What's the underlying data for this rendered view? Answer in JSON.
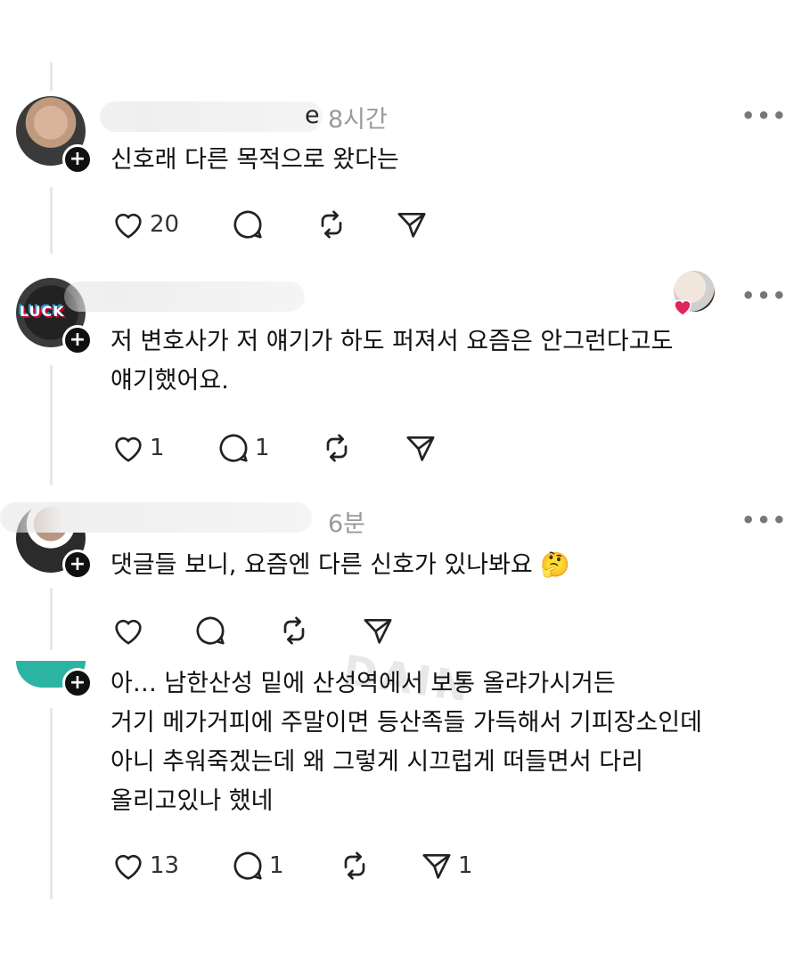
{
  "watermark": "DAIN",
  "comments": [
    {
      "time": "8시간",
      "name_fragment": "e",
      "text_lines": [
        "신호래 다른 목적으로 왔다는"
      ],
      "likes": "20",
      "replies": "",
      "reposts": "",
      "shares": ""
    },
    {
      "time": "",
      "avatar_text": "LUCK",
      "text_lines": [
        "저 변호사가 저 얘기가 하도 퍼져서 요즘은 안그런다고도",
        "얘기했어요."
      ],
      "likes": "1",
      "replies": "1",
      "reposts": "",
      "shares": ""
    },
    {
      "time": "6분",
      "text_lines": [
        "댓글들 보니, 요즘엔 다른 신호가 있나봐요 🤔"
      ],
      "likes": "",
      "replies": "",
      "reposts": "",
      "shares": ""
    },
    {
      "time": "",
      "text_lines": [
        "아… 남한산성 밑에 산성역에서 보통 올랴가시거든",
        "거기 메가거피에 주말이면 등산족들 가득해서 기피장소인데",
        "아니 추워죽겠는데 왜 그렇게 시끄럽게 떠들면서 다리",
        "올리고있나 했네"
      ],
      "likes": "13",
      "replies": "1",
      "reposts": "",
      "shares": "1"
    }
  ],
  "icons": {
    "more": "more-horizontal-icon",
    "follow": "plus-icon",
    "like": "heart-icon",
    "reply": "speech-bubble-icon",
    "repost": "repost-icon",
    "share": "send-icon"
  },
  "colors": {
    "liked_heart": "#e0245e",
    "follow_badge": "#101010"
  }
}
